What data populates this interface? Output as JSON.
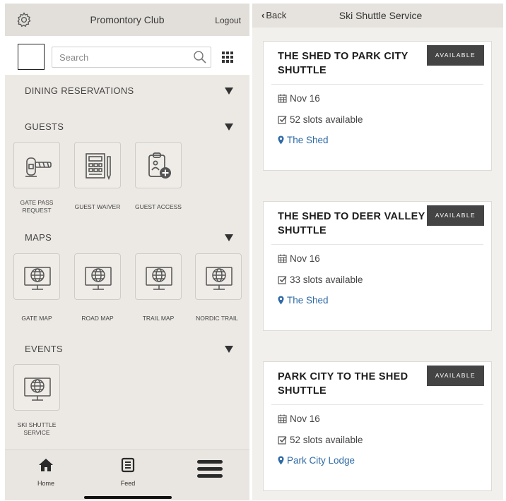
{
  "left": {
    "title": "Promontory Club",
    "logout": "Logout",
    "search_placeholder": "Search",
    "sections": [
      {
        "label": "DINING RESERVATIONS"
      },
      {
        "label": "GUESTS"
      },
      {
        "label": "MAPS"
      },
      {
        "label": "EVENTS"
      }
    ],
    "guests": [
      {
        "label": "GATE PASS REQUEST",
        "icon": "gate-barrier-icon"
      },
      {
        "label": "GUEST WAIVER",
        "icon": "form-document-icon"
      },
      {
        "label": "GUEST ACCESS",
        "icon": "clipboard-add-icon"
      }
    ],
    "maps": [
      {
        "label": "GATE MAP",
        "icon": "globe-monitor-icon"
      },
      {
        "label": "ROAD MAP",
        "icon": "globe-monitor-icon"
      },
      {
        "label": "TRAIL MAP",
        "icon": "globe-monitor-icon"
      },
      {
        "label": "NORDIC TRAIL",
        "icon": "globe-monitor-icon"
      }
    ],
    "events": [
      {
        "label": "SKI SHUTTLE SERVICE",
        "icon": "globe-monitor-icon"
      }
    ],
    "tabs": [
      {
        "label": "Home",
        "icon": "home-icon"
      },
      {
        "label": "Feed",
        "icon": "feed-icon"
      },
      {
        "label": "",
        "icon": "hamburger-menu-icon"
      }
    ]
  },
  "right": {
    "back": "Back",
    "title": "Ski Shuttle Service",
    "cards": [
      {
        "title": "THE SHED TO PARK CITY SHUTTLE",
        "badge": "AVAILABLE",
        "date": "Nov 16",
        "slots": "52 slots available",
        "location": "The Shed"
      },
      {
        "title": "THE SHED TO DEER VALLEY SHUTTLE",
        "badge": "AVAILABLE",
        "date": "Nov 16",
        "slots": "33 slots available",
        "location": "The Shed"
      },
      {
        "title": "PARK CITY TO THE SHED SHUTTLE",
        "badge": "AVAILABLE",
        "date": "Nov 16",
        "slots": "52 slots available",
        "location": "Park City Lodge"
      }
    ]
  },
  "colors": {
    "left_background": "#ece9e4",
    "header_background": "#e2dfda",
    "badge_background": "#444444",
    "link_blue": "#2e6aa6"
  }
}
